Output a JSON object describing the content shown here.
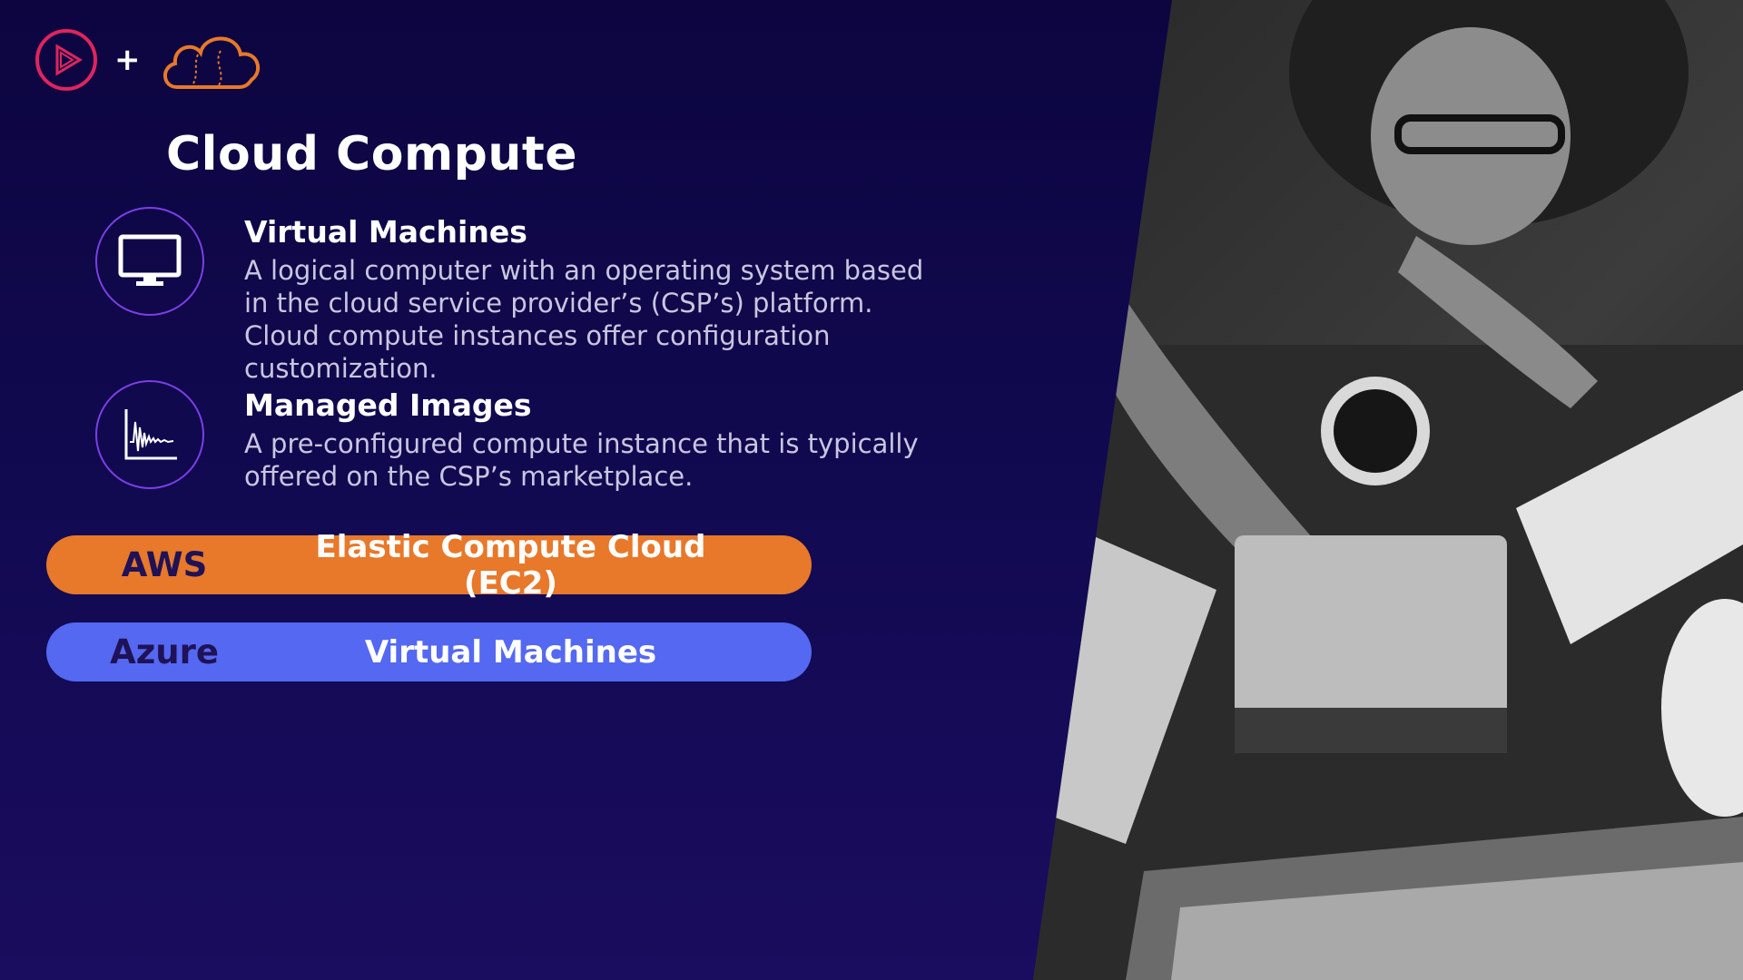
{
  "header": {
    "logo_left_icon": "play-logo-icon",
    "plus_symbol": "+",
    "logo_right_icon": "cloud-logo-icon"
  },
  "title": "Cloud Compute",
  "items": [
    {
      "icon": "monitor-icon",
      "heading": "Virtual Machines",
      "description": "A logical computer with an operating system based in the cloud service provider’s (CSP’s) platform. Cloud compute instances offer configuration customization."
    },
    {
      "icon": "waveform-icon",
      "heading": "Managed Images",
      "description": "A pre-configured compute instance that is typically offered on the CSP’s marketplace."
    }
  ],
  "providers": [
    {
      "name": "AWS",
      "service": "Elastic Compute Cloud (EC2)",
      "color": "#e8782a"
    },
    {
      "name": "Azure",
      "service": "Virtual Machines",
      "color": "#5468f2"
    }
  ],
  "colors": {
    "background": "#120a52",
    "accent_circle": "#7b3fe4",
    "logo_pink": "#e0245e",
    "logo_orange": "#e8782a"
  }
}
